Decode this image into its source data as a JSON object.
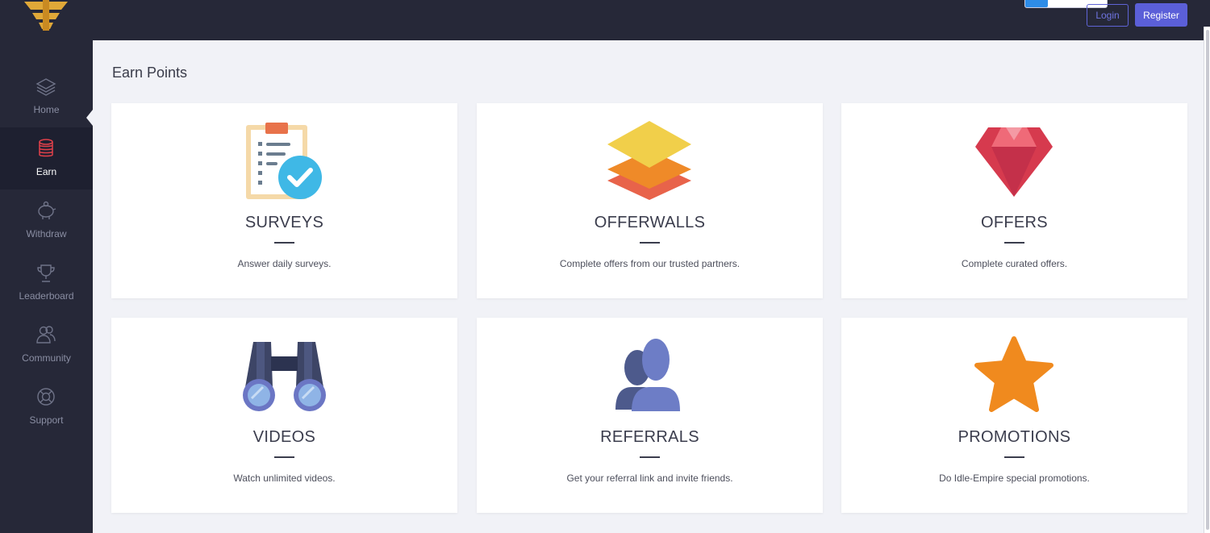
{
  "header": {
    "login_label": "Login",
    "register_label": "Register"
  },
  "sidebar": {
    "items": [
      {
        "label": "Home",
        "icon": "layers-icon"
      },
      {
        "label": "Earn",
        "icon": "coins-icon",
        "active": true
      },
      {
        "label": "Withdraw",
        "icon": "piggy-bank-icon"
      },
      {
        "label": "Leaderboard",
        "icon": "trophy-icon"
      },
      {
        "label": "Community",
        "icon": "users-icon"
      },
      {
        "label": "Support",
        "icon": "lifebuoy-icon"
      }
    ]
  },
  "main": {
    "title": "Earn Points",
    "cards": [
      {
        "title": "SURVEYS",
        "desc": "Answer daily surveys.",
        "icon": "clipboard-check-icon"
      },
      {
        "title": "OFFERWALLS",
        "desc": "Complete offers from our trusted partners.",
        "icon": "layers-stack-icon"
      },
      {
        "title": "OFFERS",
        "desc": "Complete curated offers.",
        "icon": "diamond-icon"
      },
      {
        "title": "VIDEOS",
        "desc": "Watch unlimited videos.",
        "icon": "binoculars-icon"
      },
      {
        "title": "REFERRALS",
        "desc": "Get your referral link and invite friends.",
        "icon": "users-icon"
      },
      {
        "title": "PROMOTIONS",
        "desc": "Do Idle-Empire special promotions.",
        "icon": "star-icon"
      }
    ]
  },
  "colors": {
    "sidebar_bg": "#262838",
    "accent": "#5b5fd8",
    "earn_icon": "#e0404a",
    "page_bg": "#f1f2f7"
  }
}
